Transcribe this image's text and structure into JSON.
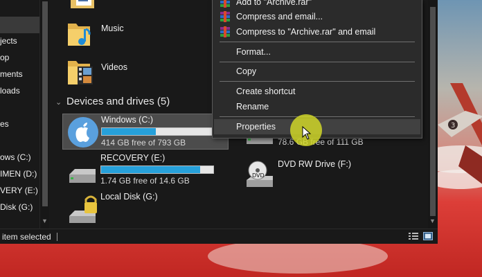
{
  "nav_pane": {
    "items": [
      {
        "label": ""
      },
      {
        "label": ""
      },
      {
        "label": "jects"
      },
      {
        "label": "op"
      },
      {
        "label": "ments"
      },
      {
        "label": "loads"
      },
      {
        "label": ""
      },
      {
        "label": "es"
      },
      {
        "label": "ows (C:)"
      },
      {
        "label": "IMEN (D:)"
      },
      {
        "label": "VERY (E:)"
      },
      {
        "label": "Disk (G:)"
      }
    ]
  },
  "folders": [
    {
      "name": "Music",
      "icon": "music-folder-icon"
    },
    {
      "name": "Videos",
      "icon": "video-folder-icon"
    }
  ],
  "devices_group": {
    "title": "Devices and drives (5)"
  },
  "drives": [
    {
      "name": "Windows (C:)",
      "free": "414 GB free of 793 GB",
      "used_fraction": 0.48,
      "icon": "apple-drive-icon",
      "selected": true
    },
    {
      "name": "RECOVERY (E:)",
      "free": "1.74 GB free of 14.6 GB",
      "used_fraction": 0.88,
      "icon": "hard-drive-icon",
      "selected": false
    },
    {
      "name": "Local Disk (G:)",
      "icon": "locked-drive-icon",
      "selected": false
    },
    {
      "name": "",
      "free": "78.6 GB free of 111 GB",
      "icon": "hard-drive-icon",
      "selected": false
    },
    {
      "name": "DVD RW Drive (F:)",
      "icon": "dvd-drive-icon",
      "selected": false
    }
  ],
  "context_menu": {
    "items": [
      {
        "label": "Add to \"Archive.rar\"",
        "icon": "winrar-icon"
      },
      {
        "label": "Compress and email...",
        "icon": "winrar-icon"
      },
      {
        "label": "Compress to \"Archive.rar\" and email",
        "icon": "winrar-icon"
      },
      {
        "label": "Format..."
      },
      {
        "label": "Copy"
      },
      {
        "label": "Create shortcut"
      },
      {
        "label": "Rename"
      },
      {
        "label": "Properties",
        "hovered": true
      }
    ]
  },
  "status_bar": {
    "text": "item selected"
  },
  "colors": {
    "accent_bar": "#26a0da",
    "cursor_highlight": "#d6dc28",
    "window_bg": "#191919"
  }
}
